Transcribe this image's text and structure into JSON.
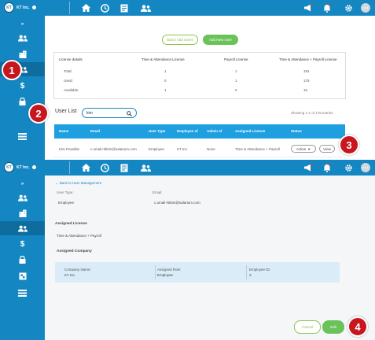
{
  "app": {
    "company": "KT Inc.",
    "logo_text": "KT"
  },
  "colors": {
    "primary": "#1487c2",
    "accent_green": "#6ac259",
    "marker_red": "#c8161e",
    "table_header": "#1e9fe0"
  },
  "nav_icons": [
    "home-icon",
    "clock-icon",
    "document-icon",
    "users-icon"
  ],
  "top_right_icons": [
    "megaphone-icon",
    "bell-icon",
    "gear-icon",
    "avatar"
  ],
  "sidebar_icons": [
    "expand-icon",
    "users-icon",
    "building-icon",
    "users-gear-icon",
    "dollar-icon",
    "lock-icon",
    "briefcase-icon",
    "table-icon"
  ],
  "panel1": {
    "buttons": {
      "batch_add": "Batch Add Users",
      "add_new": "Add New User"
    },
    "license": {
      "headers": [
        "License details",
        "Time & Attendance License",
        "Payroll License",
        "Time & Attendance + Payroll License"
      ],
      "rows": [
        [
          "Total:",
          "1",
          "1",
          "191"
        ],
        [
          "Used:",
          "0",
          "1",
          "175"
        ],
        [
          "Available:",
          "1",
          "0",
          "16"
        ]
      ]
    },
    "user_list_title": "User List",
    "search_value": "kim",
    "showing": "Showing 1-1 of 178 entries",
    "table_headers": [
      "Name",
      "Email",
      "User Type",
      "Employee of",
      "Admin of",
      "Assigned License",
      "Status"
    ],
    "row": {
      "name": "Kim Possible",
      "email": "c.umali+ktkim@salarium.com",
      "user_type": "Employee",
      "employee_of": "KT Inc.",
      "admin_of": "None",
      "assigned_license": "Time & Attendance + Payroll",
      "status": "Active",
      "view": "View"
    }
  },
  "panel2": {
    "back": "Back to User Management",
    "user_type_label": "User Type:",
    "user_type_value": "Employee",
    "email_label": "Email:",
    "email_value": "c.umali+ktkim@salarium.com",
    "assigned_license_title": "Assigned License",
    "assigned_license_value": "Time & Attendance + Payroll",
    "assigned_company_title": "Assigned Company",
    "company": {
      "company_name_label": "Company Name:",
      "company_name_value": "KT Inc.",
      "role_label": "Assigned Role:",
      "role_value": "Employee",
      "employee_id_label": "Employee ID:",
      "employee_id_value": "3"
    },
    "buttons": {
      "cancel": "Cancel",
      "edit": "Edit"
    }
  },
  "markers": [
    "1",
    "2",
    "3",
    "4"
  ]
}
